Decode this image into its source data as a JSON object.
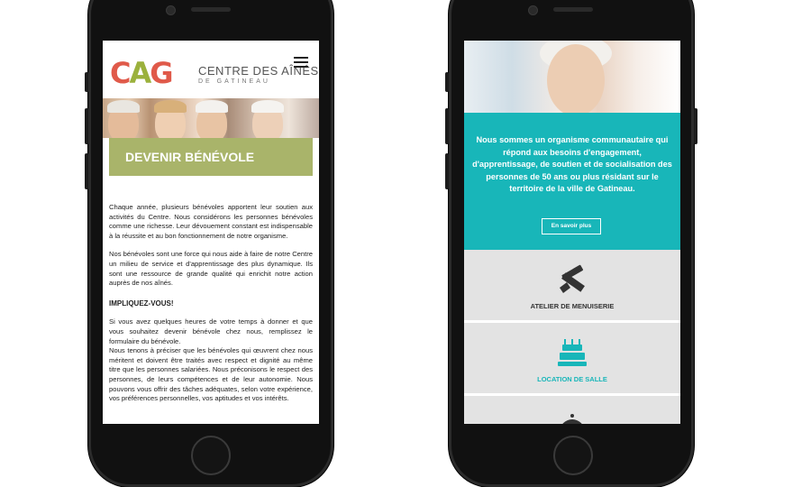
{
  "left_phone": {
    "logo": {
      "letters": "CAG",
      "title": "CENTRE DES AÎNÉS",
      "subtitle": "DE GATINEAU"
    },
    "menu_icon": "hamburger-icon",
    "section_title": "DEVENIR BÉNÉVOLE",
    "paragraphs": [
      "Chaque année, plusieurs bénévoles apportent leur soutien aux activités du Centre. Nous considérons les personnes bénévoles comme une richesse. Leur dévouement constant est indispensable à la réussite et au bon fonctionnement de notre organisme.",
      "Nos bénévoles sont une force qui nous aide à faire de notre Centre un milieu de service et d'apprentissage des plus dynamique. Ils sont une ressource de grande qualité qui enrichit notre action auprès de nos aînés."
    ],
    "subheading": "IMPLIQUEZ-VOUS!",
    "paragraphs_2": [
      "Si vous avez quelques heures de votre temps à donner et que vous souhaitez devenir bénévole chez nous, remplissez le formulaire du bénévole.",
      "Nous tenons à préciser que les bénévoles qui œuvrent chez nous méritent et doivent être traités avec respect et dignité au même titre que les personnes salariées. Nous préconisons le respect des personnes, de leurs compétences et de leur autonomie. Nous pouvons vous offrir des tâches adéquates, selon votre expérience, vos préférences personnelles, vos aptitudes et vos intérêts."
    ]
  },
  "right_phone": {
    "intro_text": "Nous sommes un organisme communautaire qui répond aux besoins d'engagement, d'apprentissage, de soutien et de socialisation des personnes de 50 ans ou plus résidant sur le territoire de la ville de Gatineau.",
    "button_label": "En savoir plus",
    "tiles": [
      {
        "label": "ATELIER DE MENUISERIE",
        "icon": "saw-hammer-icon",
        "color": "#333333"
      },
      {
        "label": "LOCATION DE SALLE",
        "icon": "cake-icon",
        "color": "#18b6b9"
      },
      {
        "label": "",
        "icon": "cloche-icon",
        "color": "#333333"
      }
    ]
  },
  "colors": {
    "teal": "#18b6b9",
    "olive": "#a9b46a",
    "logo_red": "#e05a4a",
    "logo_green": "#9bb13c"
  }
}
